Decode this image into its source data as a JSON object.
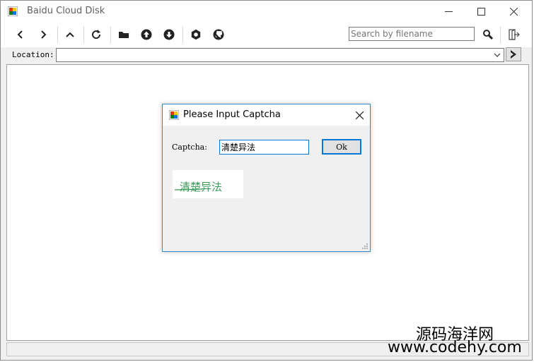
{
  "window": {
    "title": "Baidu Cloud Disk",
    "accent": "#0078d7"
  },
  "toolbar": {
    "buttons": [
      {
        "name": "back",
        "icon": "chevron-left-icon"
      },
      {
        "name": "forward",
        "icon": "chevron-right-icon"
      },
      {
        "name": "up",
        "icon": "chevron-up-icon"
      },
      {
        "name": "refresh",
        "icon": "refresh-icon"
      },
      {
        "name": "new-folder",
        "icon": "folder-icon"
      },
      {
        "name": "upload",
        "icon": "upload-icon"
      },
      {
        "name": "download",
        "icon": "download-icon"
      },
      {
        "name": "settings",
        "icon": "gear-icon"
      },
      {
        "name": "github",
        "icon": "github-icon"
      }
    ],
    "search": {
      "placeholder": "Search by filename",
      "value": ""
    },
    "search_icon": "magnifier-icon",
    "logout_icon": "logout-icon"
  },
  "location": {
    "label": "Location:",
    "value": ""
  },
  "dialog": {
    "title": "Please Input Captcha",
    "captcha_label": "Captcha:",
    "captcha_value": "清楚异法",
    "ok_label": "Ok",
    "captcha_text": "清楚异法"
  },
  "watermark": {
    "cn": "源码海洋网",
    "url": "www.codehy.com"
  }
}
